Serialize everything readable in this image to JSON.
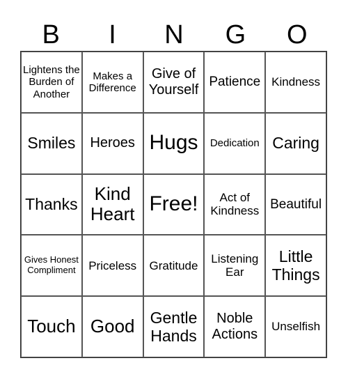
{
  "header": [
    "B",
    "I",
    "N",
    "G",
    "O"
  ],
  "cells": [
    [
      "Lightens the Burden of Another",
      "Makes a Difference",
      "Give of Yourself",
      "Patience",
      "Kindness"
    ],
    [
      "Smiles",
      "Heroes",
      "Hugs",
      "Dedication",
      "Caring"
    ],
    [
      "Thanks",
      "Kind Heart",
      "Free!",
      "Act of Kindness",
      "Beautiful"
    ],
    [
      "Gives Honest Compliment",
      "Priceless",
      "Gratitude",
      "Listening Ear",
      "Little Things"
    ],
    [
      "Touch",
      "Good",
      "Gentle Hands",
      "Noble Actions",
      "Unselfish"
    ]
  ]
}
